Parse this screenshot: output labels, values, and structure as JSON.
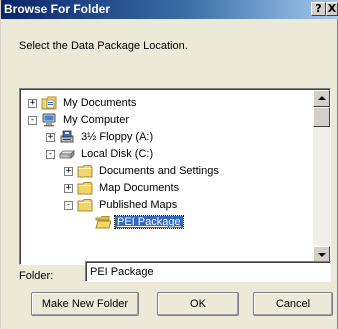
{
  "window": {
    "title": "Browse For Folder",
    "help_glyph": "?",
    "close_glyph": "X"
  },
  "prompt": "Select the Data Package Location.",
  "tree": [
    {
      "label": "My Documents",
      "icon": "my-documents-icon",
      "expander": "+"
    },
    {
      "label": "My Computer",
      "icon": "my-computer-icon",
      "expander": "-"
    },
    {
      "label": "3½ Floppy (A:)",
      "icon": "floppy-drive-icon",
      "expander": "+"
    },
    {
      "label": "Local Disk (C:)",
      "icon": "hard-disk-icon",
      "expander": "-"
    },
    {
      "label": "Documents and Settings",
      "icon": "folder-icon",
      "expander": "+"
    },
    {
      "label": "Map Documents",
      "icon": "folder-icon",
      "expander": "+"
    },
    {
      "label": "Published Maps",
      "icon": "folder-icon",
      "expander": "-"
    },
    {
      "label": "PEI Package",
      "icon": "open-folder-icon",
      "expander": "",
      "selected": true
    }
  ],
  "folder": {
    "label": "Folder:",
    "value": "PEI Package"
  },
  "buttons": {
    "make_new_folder": "Make New Folder",
    "ok": "OK",
    "cancel": "Cancel"
  },
  "colors": {
    "selection": "#316ac5",
    "titlebar": "#0a246a",
    "folder": "#f3d56a"
  }
}
